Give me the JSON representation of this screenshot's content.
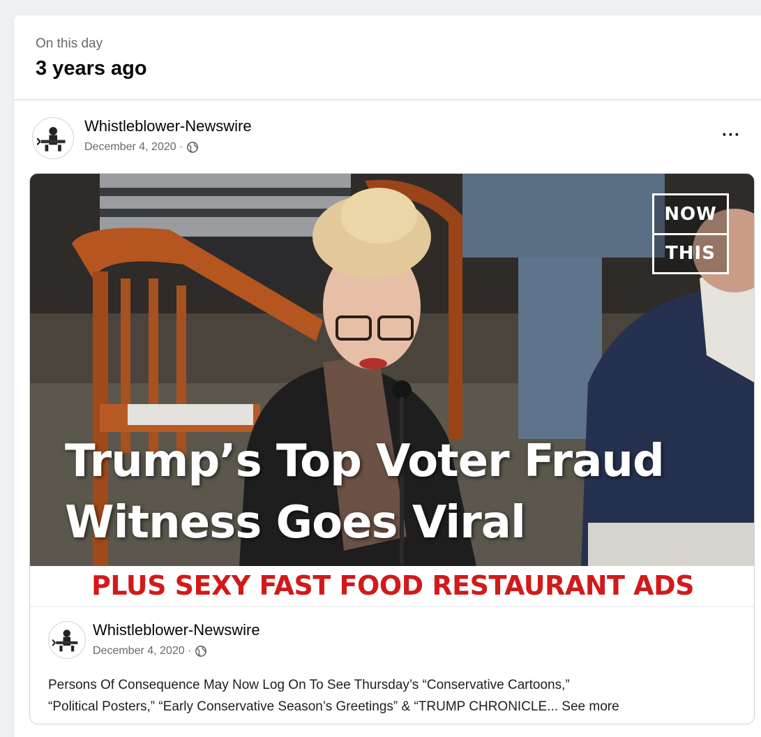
{
  "on_this_day": {
    "label": "On this day",
    "title": "3 years ago"
  },
  "post": {
    "author": "Whistleblower-Newswire",
    "date": "December 4, 2020 ·",
    "privacy_icon": "globe-icon",
    "more_label": "···"
  },
  "media": {
    "badge_top": "NOW",
    "badge_bottom": "THIS",
    "headline_line1": "Trump’s Top Voter Fraud",
    "headline_line2": "Witness Goes Viral",
    "banner": "PLUS SEXY FAST FOOD RESTAURANT ADS"
  },
  "inner_post": {
    "author": "Whistleblower-Newswire",
    "date": "December 4, 2020 ·",
    "text_line1": "Persons Of Consequence May Now Log On To See Thursday’s “Conservative Cartoons,”",
    "text_line2": "“Political Posters,” “Early Conservative Season’s Greetings” & “TRUMP CHRONICLE...",
    "see_more": "See more"
  },
  "colors": {
    "banner_red": "#d11a1a",
    "muted": "#65676b"
  }
}
